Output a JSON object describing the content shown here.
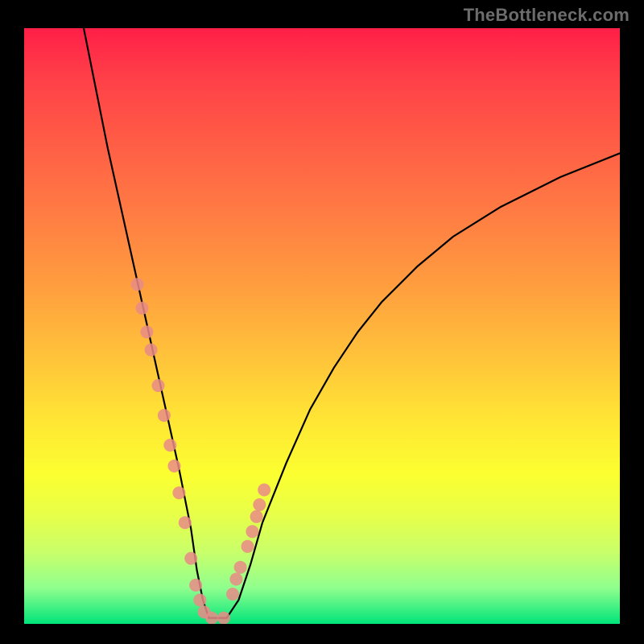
{
  "watermark": "TheBottleneck.com",
  "chart_data": {
    "type": "line",
    "title": "",
    "xlabel": "",
    "ylabel": "",
    "xlim": [
      0,
      100
    ],
    "ylim": [
      0,
      100
    ],
    "series": [
      {
        "name": "bottleneck-curve",
        "x": [
          10,
          12,
          14,
          16,
          18,
          20,
          22,
          24,
          26,
          28,
          29,
          30,
          31,
          32,
          34,
          36,
          38,
          40,
          44,
          48,
          52,
          56,
          60,
          66,
          72,
          80,
          90,
          100
        ],
        "values": [
          100,
          90,
          80,
          71,
          62,
          53,
          44,
          35,
          26,
          16,
          9,
          4,
          1,
          1,
          1,
          4,
          10,
          17,
          27,
          36,
          43,
          49,
          54,
          60,
          65,
          70,
          75,
          79
        ]
      }
    ],
    "markers": {
      "name": "highlight-points",
      "x": [
        19.0,
        19.8,
        20.6,
        21.3,
        22.5,
        23.5,
        24.5,
        25.2,
        26.0,
        27.0,
        28.0,
        28.8,
        29.5,
        30.2,
        31.5,
        33.5,
        35.0,
        35.6,
        36.3,
        37.5,
        38.3,
        39.0,
        39.5,
        40.3
      ],
      "values": [
        57,
        53,
        49,
        46,
        40,
        35,
        30,
        26.5,
        22,
        17,
        11,
        6.5,
        4.0,
        2.0,
        1.0,
        1.0,
        5.0,
        7.5,
        9.5,
        13.0,
        15.5,
        18.0,
        20.0,
        22.5
      ]
    },
    "grid": false,
    "legend": false
  }
}
